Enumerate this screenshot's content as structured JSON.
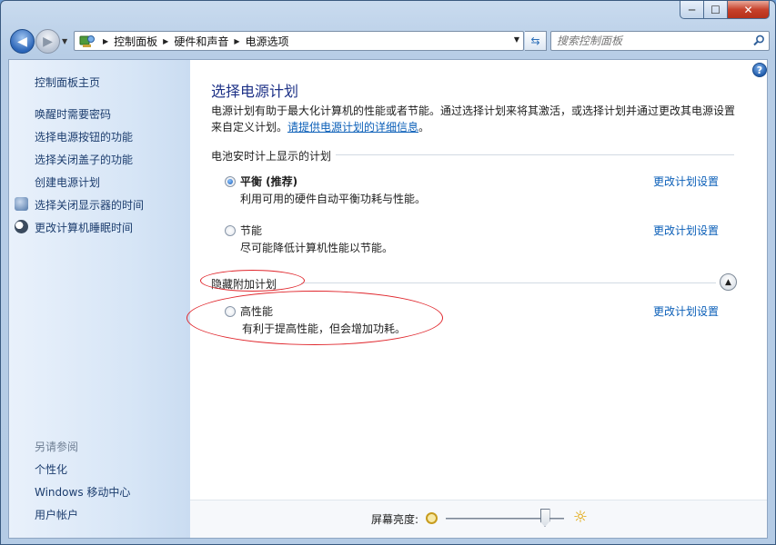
{
  "window": {
    "caption": {
      "minimize": "─",
      "maximize": "☐",
      "close": "✕"
    }
  },
  "nav": {
    "breadcrumbs": [
      "控制面板",
      "硬件和声音",
      "电源选项"
    ],
    "search_placeholder": "搜索控制面板"
  },
  "sidebar": {
    "home": "控制面板主页",
    "links": [
      {
        "label": "唤醒时需要密码",
        "icon": null
      },
      {
        "label": "选择电源按钮的功能",
        "icon": null
      },
      {
        "label": "选择关闭盖子的功能",
        "icon": null
      },
      {
        "label": "创建电源计划",
        "icon": null
      },
      {
        "label": "选择关闭显示器的时间",
        "icon": "monitor-icon"
      },
      {
        "label": "更改计算机睡眠时间",
        "icon": "moon-icon"
      }
    ],
    "see_also_heading": "另请参阅",
    "see_also": [
      "个性化",
      "Windows 移动中心",
      "用户帐户"
    ]
  },
  "main": {
    "title": "选择电源计划",
    "description": "电源计划有助于最大化计算机的性能或者节能。通过选择计划来将其激活，或选择计划并通过更改其电源设置来自定义计划。",
    "description_link": "请提供电源计划的详细信息",
    "description_end": "。",
    "battery_group": "电池安时计上显示的计划",
    "hidden_group": "隐藏附加计划",
    "change_label": "更改计划设置",
    "plans": [
      {
        "name": "平衡 (推荐)",
        "desc": "利用可用的硬件自动平衡功耗与性能。",
        "selected": true
      },
      {
        "name": "节能",
        "desc": "尽可能降低计算机性能以节能。",
        "selected": false
      },
      {
        "name": "高性能",
        "desc": "有利于提高性能，但会增加功耗。",
        "selected": false
      }
    ],
    "brightness_label": "屏幕亮度:",
    "brightness_level": 0.85
  },
  "colors": {
    "link": "#0b5fb8",
    "title": "#1e3287",
    "annotation": "#e0262c"
  }
}
